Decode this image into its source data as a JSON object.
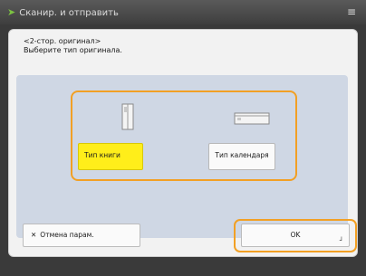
{
  "app": {
    "title": "Сканир. и отправить",
    "title_icon": "send-icon",
    "menu_icon": "hamburger-menu-icon"
  },
  "dialog": {
    "line1": "<2-стор. оригинал>",
    "line2": "Выберите тип оригинала."
  },
  "options": [
    {
      "label": "Тип книги",
      "selected": true,
      "icon": "book-original-icon"
    },
    {
      "label": "Тип календаря",
      "selected": false,
      "icon": "calendar-original-icon"
    }
  ],
  "footer": {
    "cancel_label": "Отмена парам.",
    "cancel_icon": "close-icon",
    "ok_label": "OK"
  },
  "colors": {
    "selected": "#ffee1a",
    "focus_outline": "#f2a024",
    "panel": "#cfd7e4",
    "accent_green": "#7cc242"
  }
}
